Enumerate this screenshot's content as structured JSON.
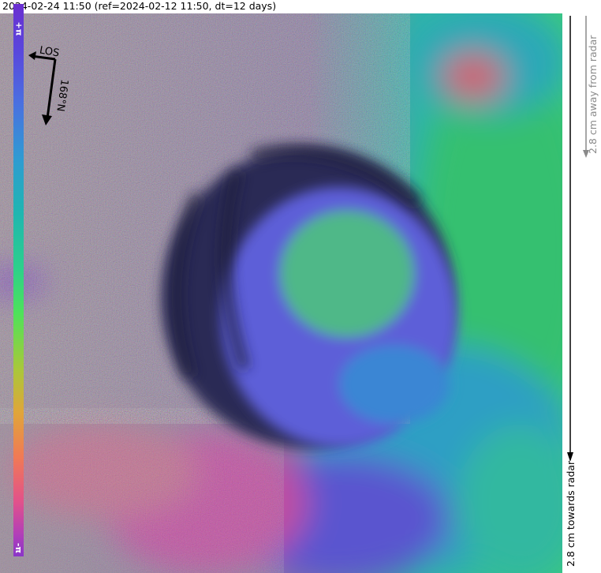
{
  "header": {
    "title": "2024-02-24 11:50 (ref=2024-02-12 11:50, dt=12 days)"
  },
  "compass": {
    "los_label": "LOS",
    "heading_label": "168°N"
  },
  "colorbar": {
    "top_label": "+π",
    "bottom_label": "-π",
    "away_label": "2.8 cm away from radar",
    "towards_label": "2.8 cm towards radar"
  },
  "colors": {
    "away_arrow": "#8a8a8a",
    "towards_arrow": "#000000"
  }
}
